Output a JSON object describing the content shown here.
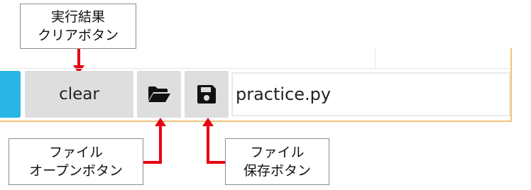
{
  "callouts": {
    "clear": {
      "line1": "実行結果",
      "line2": "クリアボタン"
    },
    "open": {
      "line1": "ファイル",
      "line2": "オープンボタン"
    },
    "save": {
      "line1": "ファイル",
      "line2": "保存ボタン"
    }
  },
  "toolbar": {
    "clear_label": "clear",
    "open_icon": "folder-open-icon",
    "save_icon": "floppy-disk-icon",
    "filename_value": "practice.py"
  },
  "colors": {
    "accent_blue": "#29b6e4",
    "button_bg": "#dedede",
    "arrow_red": "#e60012",
    "frame_orange": "#f2c27a"
  }
}
